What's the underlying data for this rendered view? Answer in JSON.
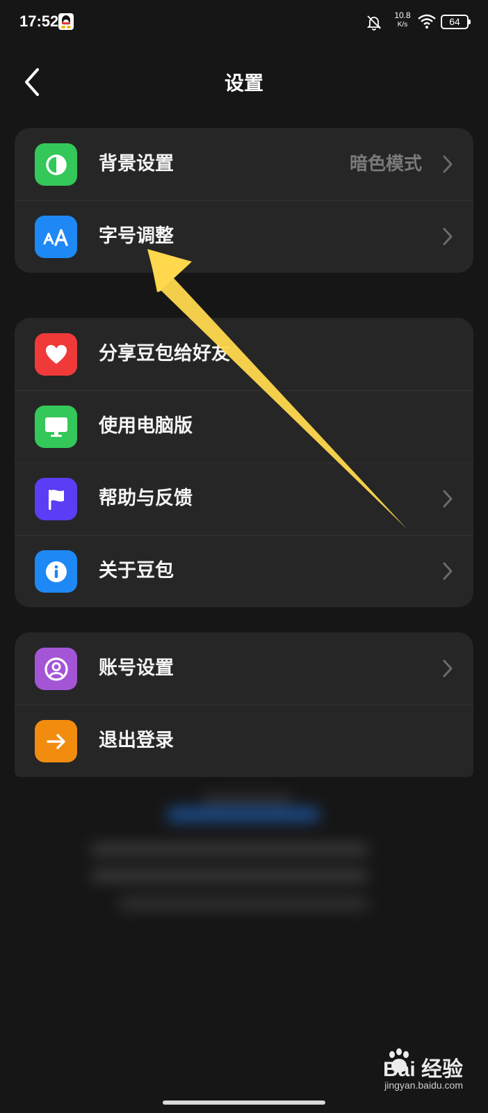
{
  "status_bar": {
    "time": "17:52",
    "net_speed_value": "10.8",
    "net_speed_unit": "K/s",
    "battery": "64"
  },
  "header": {
    "title": "设置"
  },
  "groups": [
    {
      "items": [
        {
          "label": "背景设置",
          "value": "暗色模式",
          "icon": "contrast-icon",
          "color": "#34c759",
          "chevron": true
        },
        {
          "label": "字号调整",
          "value": "",
          "icon": "font-size-icon",
          "color": "#1e88f5",
          "chevron": true
        }
      ]
    },
    {
      "items": [
        {
          "label": "分享豆包给好友",
          "icon": "heart-icon",
          "color": "#f03a3a",
          "chevron": false
        },
        {
          "label": "使用电脑版",
          "icon": "monitor-icon",
          "color": "#34c759",
          "chevron": false
        },
        {
          "label": "帮助与反馈",
          "icon": "flag-icon",
          "color": "#5b3df5",
          "chevron": true
        },
        {
          "label": "关于豆包",
          "icon": "info-icon",
          "color": "#1e88f5",
          "chevron": true
        }
      ]
    },
    {
      "items": [
        {
          "label": "账号设置",
          "icon": "user-icon",
          "color": "#a455d6",
          "chevron": true
        },
        {
          "label": "退出登录",
          "icon": "arrow-right-icon",
          "color": "#f28c0f",
          "chevron": false
        }
      ]
    }
  ],
  "annotation": {
    "arrow_color": "#ffd84d"
  },
  "watermark": {
    "text": "Bai 经验",
    "sub": "jingyan.baidu.com"
  }
}
